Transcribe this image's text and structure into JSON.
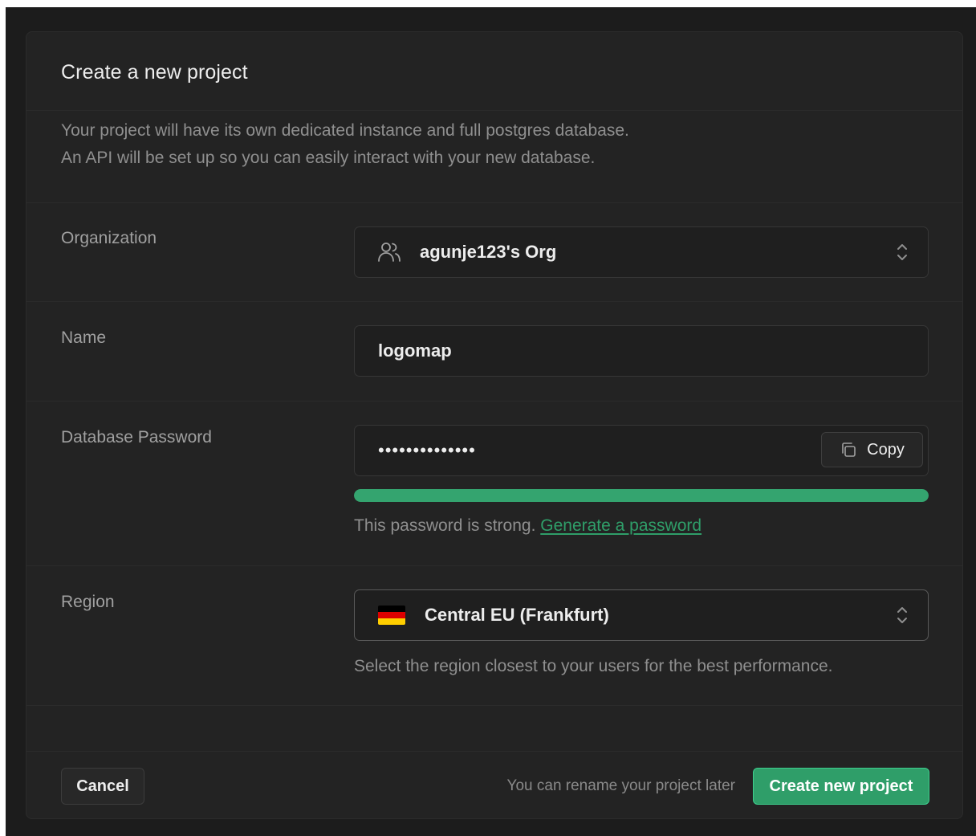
{
  "dialog": {
    "title": "Create a new project",
    "description_line1": "Your project will have its own dedicated instance and full postgres database.",
    "description_line2": "An API will be set up so you can easily interact with your new database."
  },
  "organization": {
    "label": "Organization",
    "value": "agunje123's Org",
    "icon": "users-icon"
  },
  "name": {
    "label": "Name",
    "value": "logomap"
  },
  "password": {
    "label": "Database Password",
    "value": "••••••••••••••",
    "copy_label": "Copy",
    "strength_fraction": 1.0,
    "strength_color": "#34a46f",
    "helper_text": "This password is strong.",
    "generate_link": "Generate a password"
  },
  "region": {
    "label": "Region",
    "value": "Central EU (Frankfurt)",
    "flag": "germany-flag",
    "helper_text": "Select the region closest to your users for the best performance."
  },
  "footer": {
    "cancel_label": "Cancel",
    "note": "You can rename your project later",
    "create_label": "Create new project"
  },
  "colors": {
    "accent": "#3ecf8e",
    "panel_bg": "#232323"
  }
}
